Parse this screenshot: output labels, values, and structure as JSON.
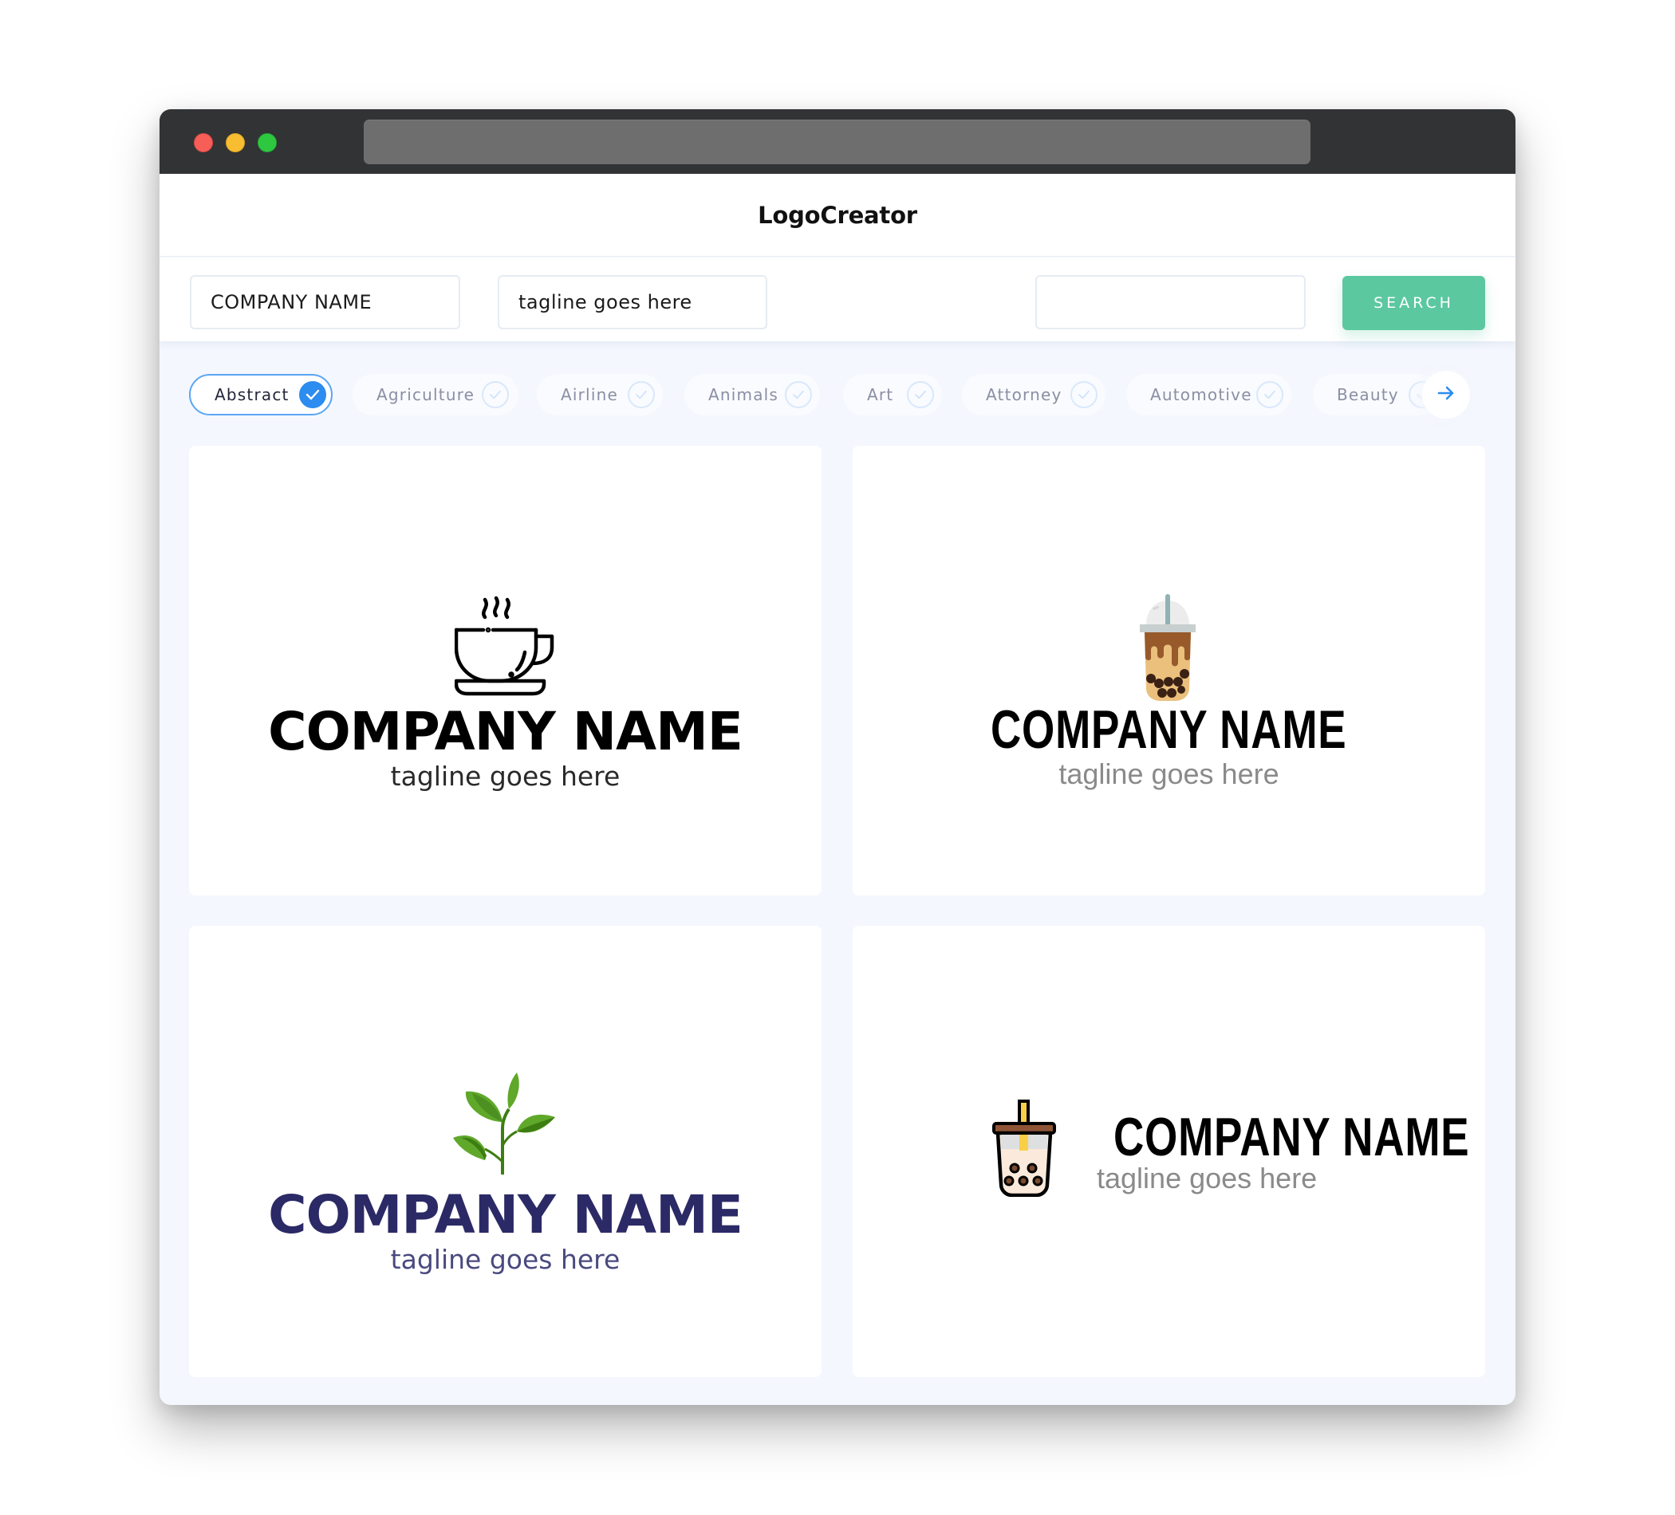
{
  "window": {
    "controls": [
      "close",
      "minimize",
      "maximize"
    ]
  },
  "header": {
    "brand": "LogoCreator"
  },
  "search": {
    "company_name_value": "COMPANY NAME",
    "tagline_value": "tagline goes here",
    "extra_value": "",
    "button_label": "SEARCH"
  },
  "categories": {
    "items": [
      {
        "label": "Abstract",
        "selected": true
      },
      {
        "label": "Agriculture",
        "selected": false
      },
      {
        "label": "Airline",
        "selected": false
      },
      {
        "label": "Animals",
        "selected": false
      },
      {
        "label": "Art",
        "selected": false
      },
      {
        "label": "Attorney",
        "selected": false
      },
      {
        "label": "Automotive",
        "selected": false
      },
      {
        "label": "Beauty",
        "selected": false
      }
    ],
    "next_icon": "arrow-right-icon"
  },
  "logos": [
    {
      "icon": "coffee-cup-icon",
      "name": "COMPANY NAME",
      "tagline": "tagline goes here",
      "name_color": "#000000",
      "tagline_color": "#2a2a2a"
    },
    {
      "icon": "bubble-tea-icon",
      "name": "COMPANY NAME",
      "tagline": "tagline goes here",
      "name_color": "#000000",
      "tagline_color": "#8a8a8a"
    },
    {
      "icon": "tea-leaf-icon",
      "name": "COMPANY NAME",
      "tagline": "tagline goes here",
      "name_color": "#2b2a66",
      "tagline_color": "#4a4a80"
    },
    {
      "icon": "boba-cup-icon",
      "name": "COMPANY NAME",
      "tagline": "tagline goes here",
      "name_color": "#000000",
      "tagline_color": "#8a8a8a"
    }
  ],
  "colors": {
    "accent": "#2d8cf0",
    "search_button": "#5bc8a0",
    "titlebar": "#323335",
    "page_bg": "#f4f7fd"
  }
}
